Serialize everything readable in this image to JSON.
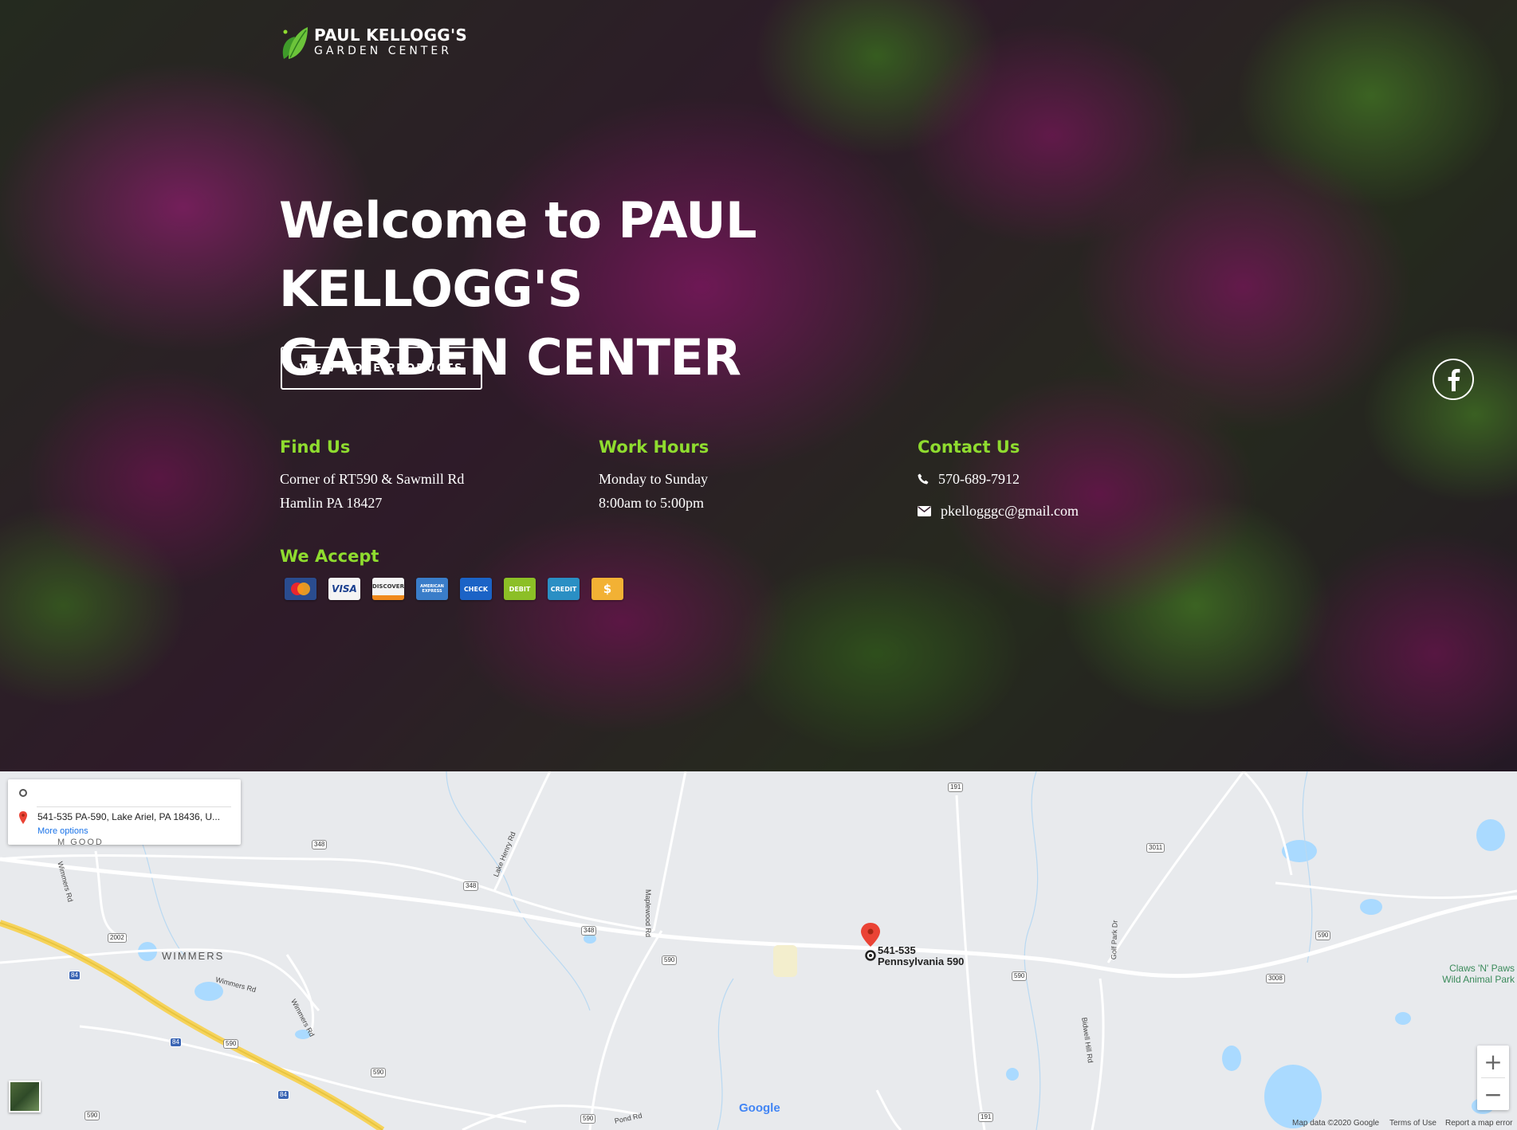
{
  "logo": {
    "line1": "PAUL KELLOGG'S",
    "line2": "GARDEN CENTER"
  },
  "hero": {
    "title_line1": "Welcome to PAUL KELLOGG'S",
    "title_line2": "GARDEN CENTER",
    "cta_label": "VIEW MORE PRODUCTS"
  },
  "social": {
    "icon": "facebook-icon"
  },
  "find_us": {
    "heading": "Find Us",
    "line1": "Corner of RT590 & Sawmill Rd",
    "line2": "Hamlin PA 18427"
  },
  "work_hours": {
    "heading": "Work Hours",
    "line1": "Monday to Sunday",
    "line2": "8:00am to 5:00pm"
  },
  "contact": {
    "heading": "Contact Us",
    "phone": "570-689-7912",
    "email": "pkellogggc@gmail.com"
  },
  "we_accept": {
    "heading": "We Accept",
    "cards": [
      {
        "name": "mastercard",
        "label": "MasterCard",
        "color": "#2a4c8f"
      },
      {
        "name": "visa",
        "label": "VISA",
        "color": "#f4f4f4"
      },
      {
        "name": "discover",
        "label": "DISCOVER",
        "color": "#f4f4f4"
      },
      {
        "name": "amex",
        "label": "AMERICAN EXPRESS",
        "color": "#3a7dc9"
      },
      {
        "name": "check",
        "label": "CHECK",
        "color": "#1b63c6"
      },
      {
        "name": "debit",
        "label": "DEBIT",
        "color": "#8cbf26"
      },
      {
        "name": "credit",
        "label": "CREDIT",
        "color": "#2a8fc4"
      },
      {
        "name": "cash",
        "label": "$",
        "color": "#f2b134"
      }
    ]
  },
  "colors": {
    "accent": "#8fdc2f",
    "text": "#ffffff"
  },
  "map": {
    "destination": "541-535 PA-590, Lake Ariel, PA 18436, U...",
    "more_options": "More options",
    "marker_label_line1": "541-535",
    "marker_label_line2": "Pennsylvania 590",
    "place_wimmers": "WIMMERS",
    "place_claws_line1": "Claws 'N' Paws",
    "place_claws_line2": "Wild Animal Park",
    "partial_top_label": "M GOOD",
    "roads": {
      "lake_henry": "Lake Henry Rd",
      "maplewood": "Maplewood Rd",
      "wimmers_rd1": "Wimmers Rd",
      "wimmers_rd2": "Wimmers Rd",
      "wimmers_rd3": "Wimmers Rd",
      "golf_park": "Golf Park Dr",
      "bidwell_hill": "Bidwell Hill Rd",
      "pond": "Pond Rd"
    },
    "shields": {
      "s191_top": "191",
      "s348_a": "348",
      "s348_b": "348",
      "s348_c": "348",
      "s3011": "3011",
      "s2002": "2002",
      "s590_a": "590",
      "s590_b": "590",
      "s590_c": "590",
      "s590_d": "590",
      "s590_e": "590",
      "s590_f": "590",
      "s590_g": "590",
      "s3008": "3008",
      "s84_a": "84",
      "s84_b": "84",
      "s84_c": "84",
      "s191_bottom": "191"
    },
    "zoom_in": "+",
    "zoom_out": "−",
    "google": "Google",
    "footer_data": "Map data ©2020 Google",
    "footer_terms": "Terms of Use",
    "footer_report": "Report a map error"
  }
}
